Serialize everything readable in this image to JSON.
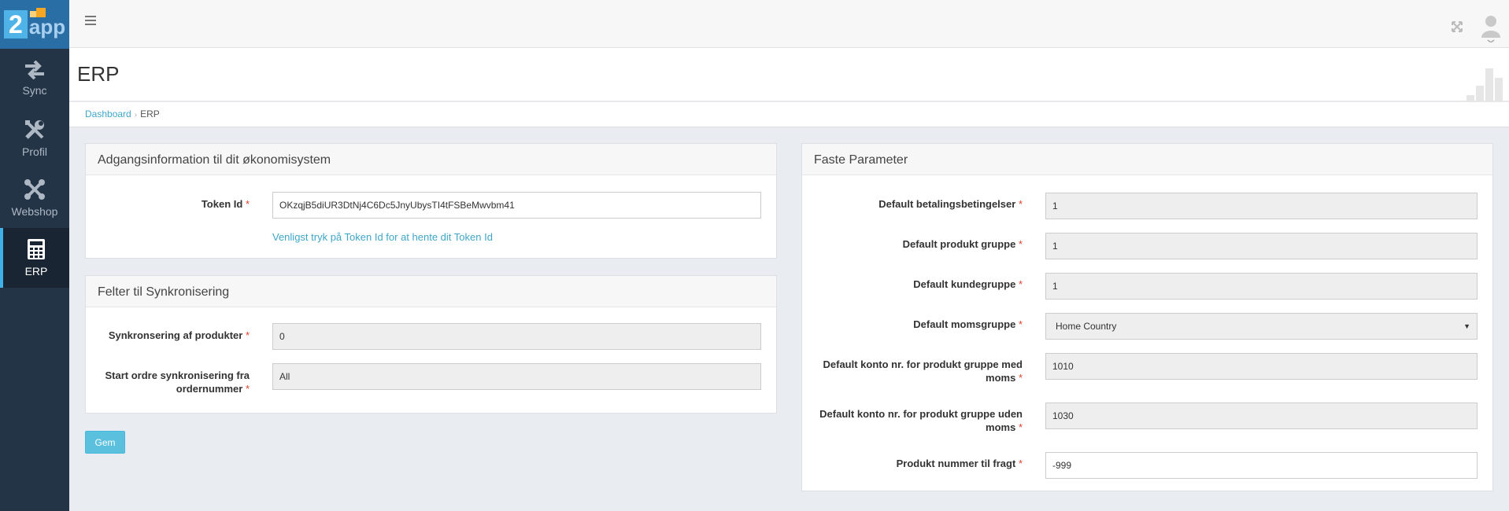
{
  "app": {
    "logo_number": "2",
    "logo_word": "app"
  },
  "sidebar": {
    "items": [
      {
        "label": "Sync",
        "icon": "arrows-icon"
      },
      {
        "label": "Profil",
        "icon": "tools-icon"
      },
      {
        "label": "Webshop",
        "icon": "joomla-icon"
      },
      {
        "label": "ERP",
        "icon": "calculator-icon"
      }
    ]
  },
  "header": {
    "title": "ERP"
  },
  "breadcrumb": {
    "home": "Dashboard",
    "current": "ERP"
  },
  "access_panel": {
    "title": "Adgangsinformation til dit økonomisystem",
    "token_label": "Token Id",
    "token_value": "OKzqjB5diUR3DtNj4C6Dc5JnyUbysTI4tFSBeMwvbm41",
    "token_help": "Venligst tryk på Token Id for at hente dit Token Id"
  },
  "sync_panel": {
    "title": "Felter til Synkronisering",
    "products_label": "Synkronsering af produkter",
    "products_value": "0",
    "orders_label_line1": "Start ordre synkronisering fra",
    "orders_label_line2": "ordernummer",
    "orders_value": "All"
  },
  "save_label": "Gem",
  "params_panel": {
    "title": "Faste Parameter",
    "fields": [
      {
        "label1": "Default betalingsbetingelser",
        "label2": "",
        "value": "1"
      },
      {
        "label1": "Default produkt gruppe",
        "label2": "",
        "value": "1"
      },
      {
        "label1": "Default kundegruppe",
        "label2": "",
        "value": "1"
      },
      {
        "label1": "Default momsgruppe",
        "label2": "",
        "value": "Home Country"
      },
      {
        "label1": "Default konto nr. for produkt gruppe med",
        "label2": "moms",
        "value": "1010"
      },
      {
        "label1": "Default konto nr. for produkt gruppe uden",
        "label2": "moms",
        "value": "1030"
      },
      {
        "label1": "Produkt nummer til fragt",
        "label2": "",
        "value": "-999"
      }
    ]
  },
  "required_mark": "*",
  "colors": {
    "sidebar": "#243447",
    "accent": "#3fa6c8",
    "button": "#5bc0de",
    "required": "#e0412c"
  }
}
